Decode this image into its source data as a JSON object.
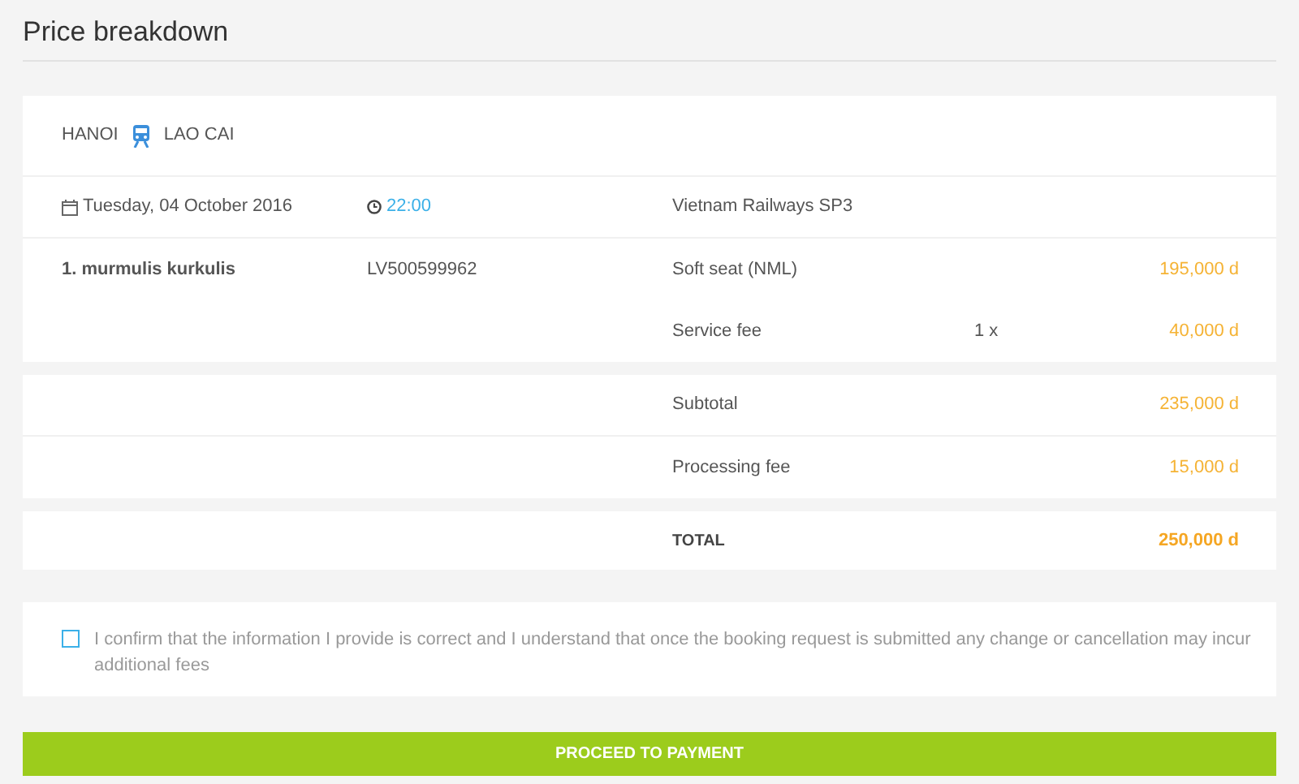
{
  "title": "Price breakdown",
  "route": {
    "from": "HANOI",
    "to": "LAO CAI"
  },
  "trip": {
    "date": "Tuesday, 04 October 2016",
    "time": "22:00",
    "operator": "Vietnam Railways SP3"
  },
  "items": [
    {
      "passenger": "1. murmulis kurkulis",
      "document": "LV500599962",
      "label": "Soft seat (NML)",
      "price": "195,000 d"
    },
    {
      "label": "Service fee",
      "quantity": "1 x",
      "price": "40,000 d"
    }
  ],
  "totals": [
    {
      "label": "Subtotal",
      "amount": "235,000 d"
    },
    {
      "label": "Processing fee",
      "amount": "15,000 d"
    }
  ],
  "grand_total": {
    "label": "TOTAL",
    "amount": "250,000 d"
  },
  "confirm": {
    "text": "I confirm that the information I provide is correct and I understand that once the booking request is submitted any change or cancellation may incur additional fees",
    "checked": false
  },
  "button": "PROCEED TO PAYMENT"
}
